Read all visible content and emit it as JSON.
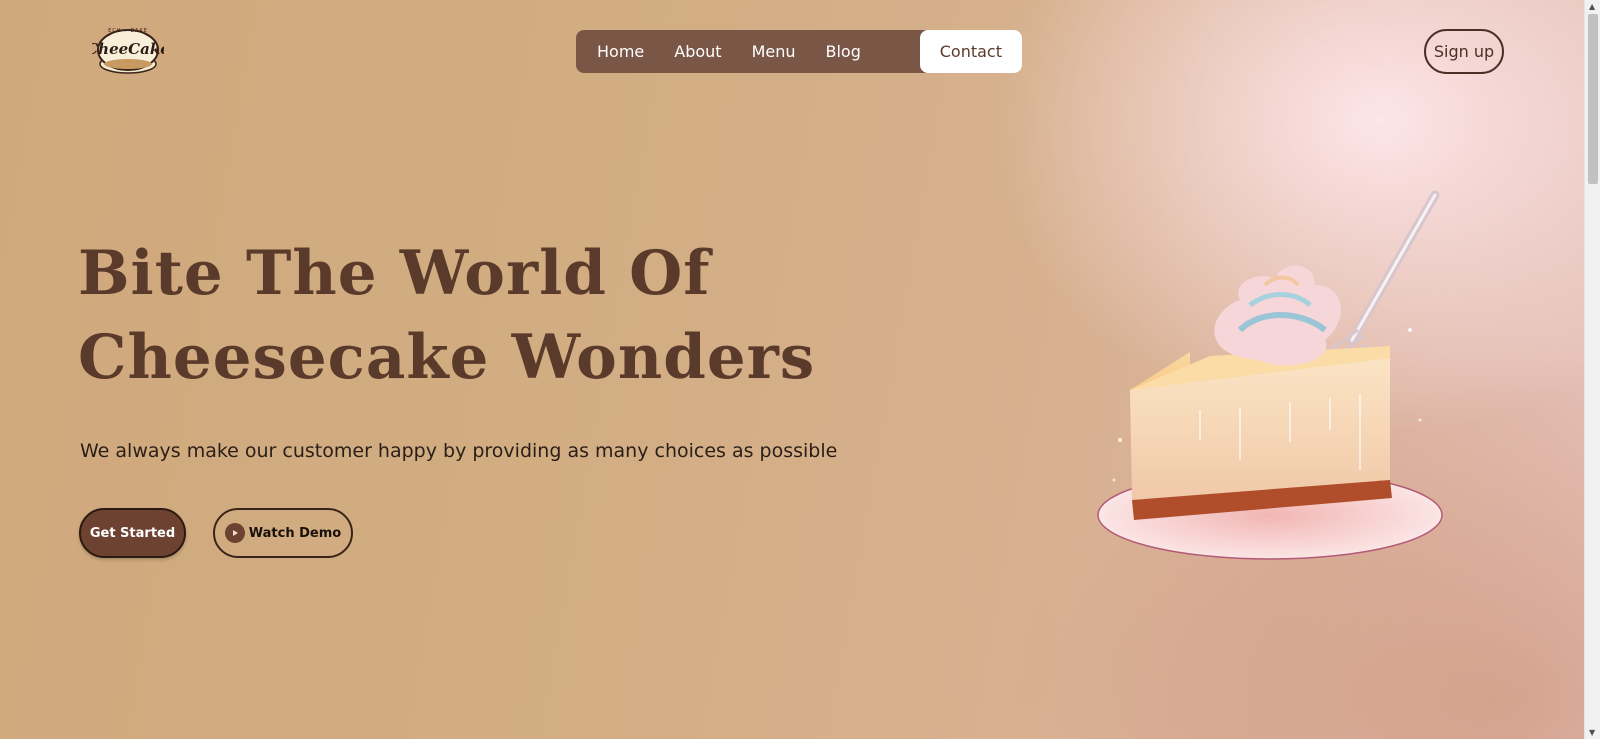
{
  "logo": {
    "text": "CheeCake",
    "tagline": "ECH • BAKE"
  },
  "nav": {
    "items": [
      {
        "label": "Home"
      },
      {
        "label": "About"
      },
      {
        "label": "Menu"
      },
      {
        "label": "Blog"
      },
      {
        "label": "Contact",
        "active": true
      }
    ]
  },
  "header": {
    "signup_label": "Sign up"
  },
  "hero": {
    "headline_line1": "Bite The World Of",
    "headline_line2": "Cheesecake Wonders",
    "subtext": "We always make our customer happy by providing as many choices as possible",
    "primary_button": "Get Started",
    "secondary_button": "Watch Demo"
  },
  "icons": {
    "play": "play-icon",
    "scroll_up": "chevron-up-icon",
    "scroll_down": "chevron-down-icon"
  },
  "colors": {
    "brand_brown": "#6e4231",
    "nav_bg": "#7a5646",
    "headline": "#5a3a2a"
  }
}
